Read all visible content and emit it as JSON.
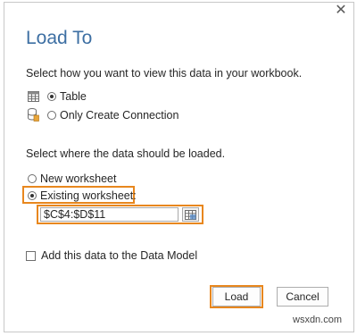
{
  "dialog": {
    "title": "Load To",
    "close_glyph": "✕",
    "view_prompt": "Select how you want to view this data in your workbook.",
    "view_options": [
      {
        "label": "Table",
        "icon": "table-icon",
        "selected": true
      },
      {
        "label": "Only Create Connection",
        "icon": "connection-icon",
        "selected": false
      }
    ],
    "location_prompt": "Select where the data should be loaded.",
    "location_options": [
      {
        "label": "New worksheet",
        "selected": false
      },
      {
        "label": "Existing worksheet:",
        "selected": true
      }
    ],
    "range_value": "$C$4:$D$11",
    "data_model_label": "Add this data to the Data Model",
    "data_model_checked": false,
    "load_label": "Load",
    "cancel_label": "Cancel"
  },
  "watermark": "wsxdn.com",
  "colors": {
    "title": "#3d6fa3",
    "highlight": "#e8871e",
    "text": "#262626"
  }
}
